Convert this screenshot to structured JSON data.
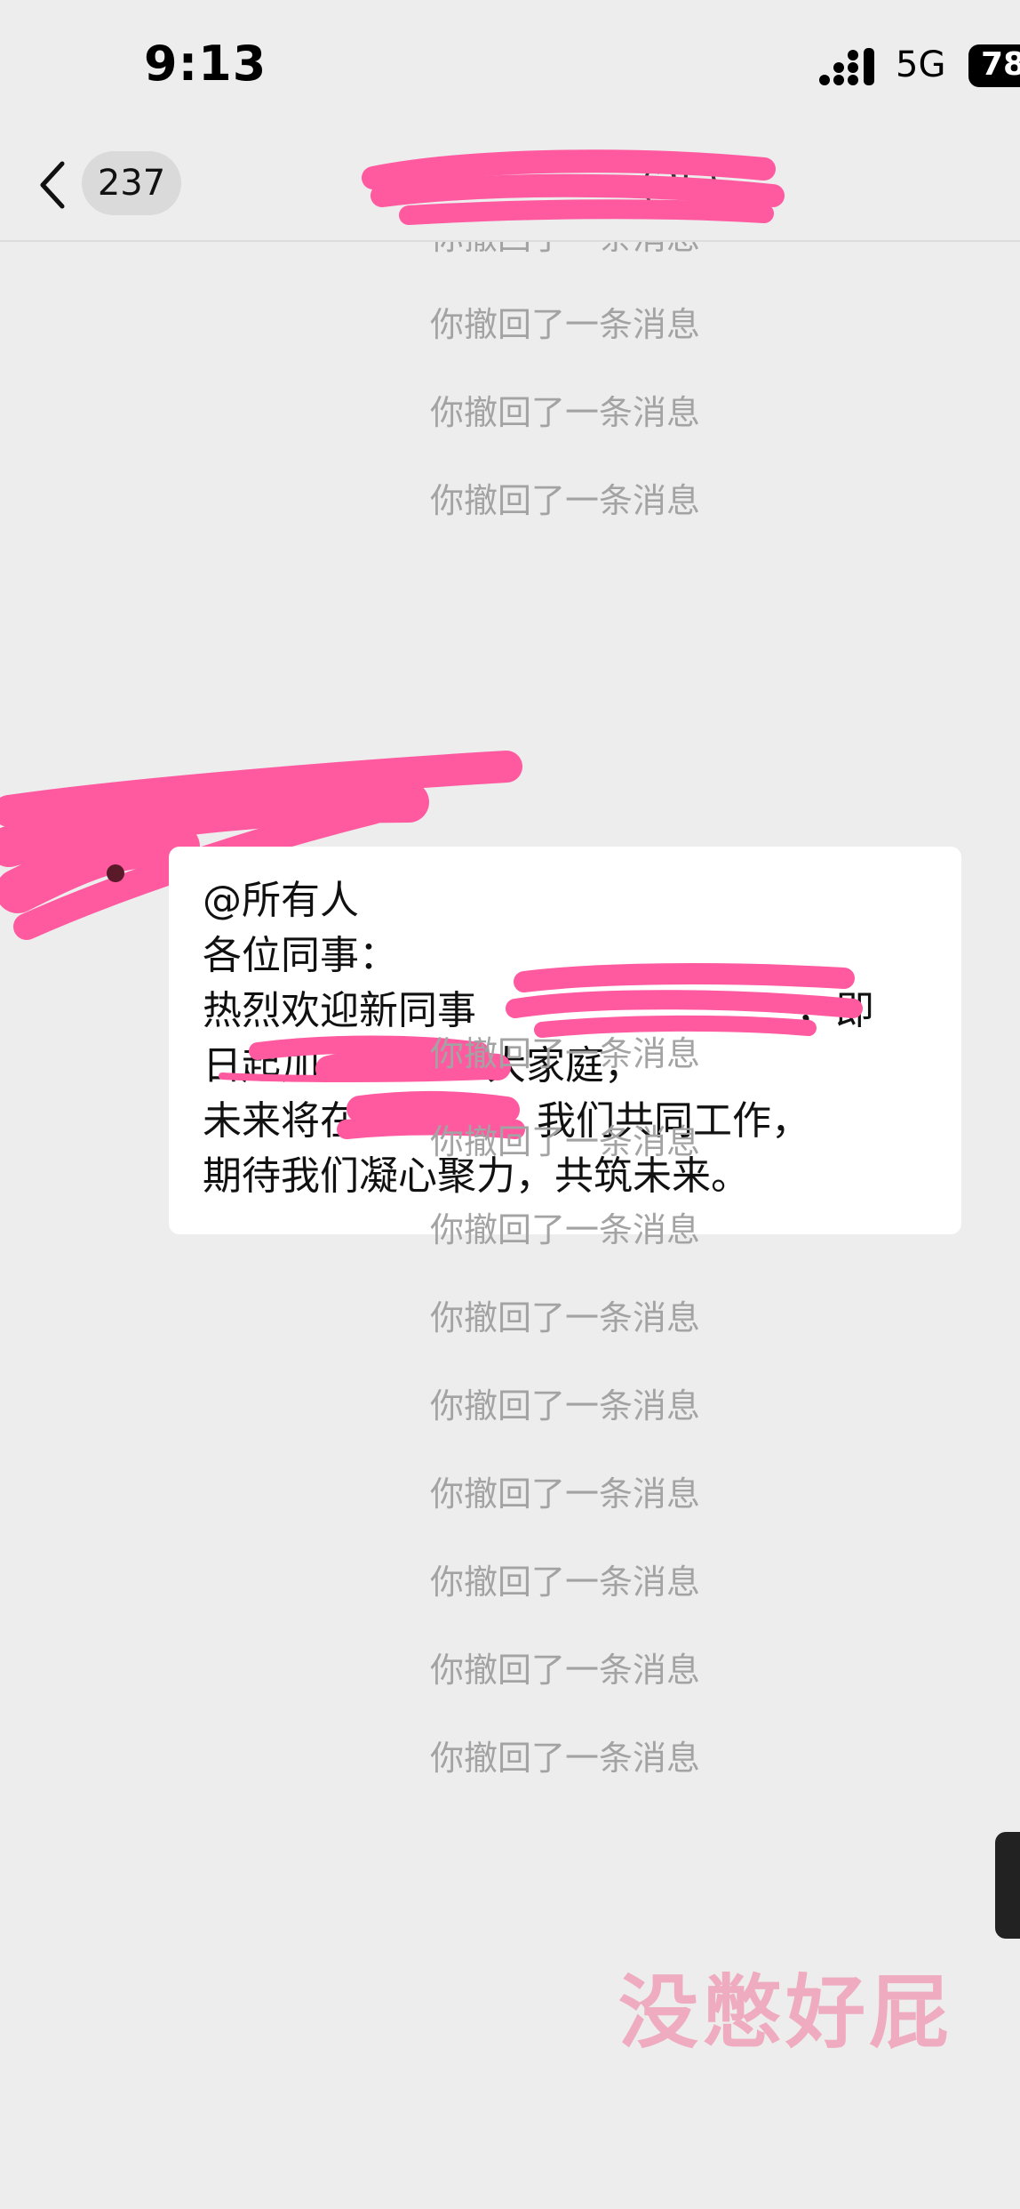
{
  "status_bar": {
    "time": "9:13",
    "network": "5G",
    "battery": "78",
    "signal_icon": "cellular-signal-icon"
  },
  "nav": {
    "back_icon": "chevron-left-icon",
    "unread_count": "237",
    "title_visible": "(25)"
  },
  "recall_text": "你撤回了一条消息",
  "message": {
    "lines": [
      "@所有人",
      "各位同事：",
      "热烈欢迎新同事",
      "日起加",
      "大家庭，",
      "未来将在",
      "我们共同工作，",
      "期待我们凝心聚力，共筑未来。"
    ],
    "comma_ji": "，即"
  },
  "watermark": "没憋好屁",
  "colors": {
    "background": "#ededed",
    "bubble": "#ffffff",
    "recall_text": "#a3a3a3",
    "redaction": "#ff5aa0",
    "watermark": "#f0a6bc"
  }
}
